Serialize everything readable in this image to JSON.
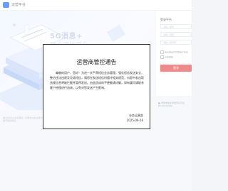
{
  "header": {
    "title": "运营平台"
  },
  "banner": {
    "headline": "5G消息+",
    "subline": "融合通信平台"
  },
  "login": {
    "title": "登录平台",
    "username_placeholder": "请输入账号",
    "password_placeholder": "请输入密码",
    "captcha_placeholder": "请输入验证码",
    "agree_label": "我已阅读并同意用户协议",
    "remember_label": "记住密码",
    "submit_label": "登录"
  },
  "qualification": {
    "line1": "增值电信业务经营许可证",
    "line2": "B2-20200000"
  },
  "footer": {
    "note": "本平台为5G消息服务，仅限合法企业用户使用，请遵守相关规定。"
  },
  "notice": {
    "title": "运营商管控通告",
    "body": "尊敬的用户，您好！为进一步严肃短信业务管理，强化短信发送安全，整治违法违规及垃圾短信，请您在发送短信时遵守相关规范，内容中若出现违规信息将被拦截并暂停发送。由此造成的不便敬请谅解，如有疑问请联系客户经理进行咨询，以免对您发送产生影响。",
    "sign": "业务运营部",
    "date": "2025-06-26"
  },
  "colors": {
    "accent": "#1e67ff",
    "login_button": "#e94b4b"
  }
}
